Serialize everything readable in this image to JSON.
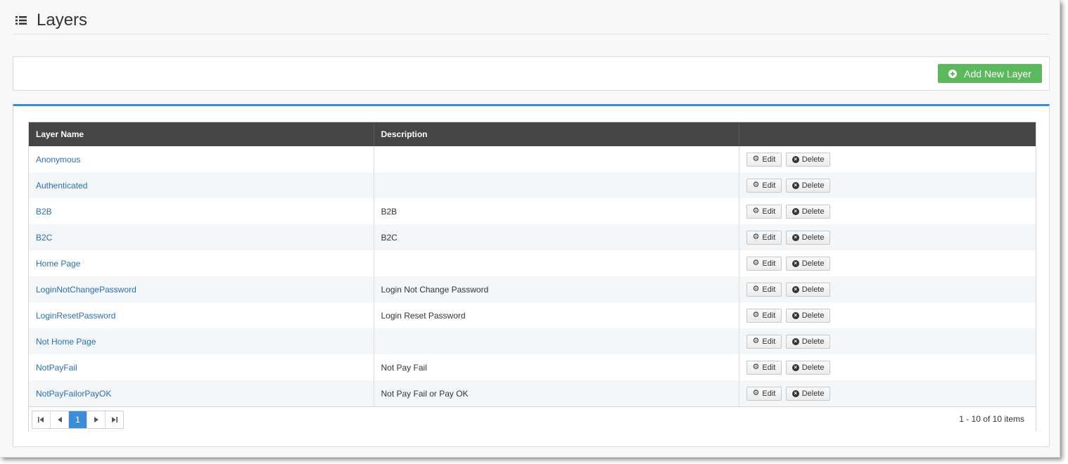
{
  "page": {
    "title": "Layers"
  },
  "toolbar": {
    "add_label": "Add New Layer",
    "add_color": "#5cb85c"
  },
  "grid": {
    "columns": [
      "Layer Name",
      "Description",
      ""
    ],
    "rows": [
      {
        "name": "Anonymous",
        "description": ""
      },
      {
        "name": "Authenticated",
        "description": ""
      },
      {
        "name": "B2B",
        "description": "B2B"
      },
      {
        "name": "B2C",
        "description": "B2C"
      },
      {
        "name": "Home Page",
        "description": ""
      },
      {
        "name": "LoginNotChangePassword",
        "description": "Login Not Change Password"
      },
      {
        "name": "LoginResetPassword",
        "description": "Login Reset Password"
      },
      {
        "name": "Not Home Page",
        "description": ""
      },
      {
        "name": "NotPayFail",
        "description": "Not Pay Fail"
      },
      {
        "name": "NotPayFailorPayOK",
        "description": "Not Pay Fail or Pay OK"
      }
    ],
    "edit_label": "Edit",
    "delete_label": "Delete"
  },
  "pager": {
    "current_page": "1",
    "first_icon": "first-page-icon",
    "prev_icon": "prev-page-icon",
    "next_icon": "next-page-icon",
    "last_icon": "last-page-icon",
    "info": "1 - 10 of 10 items"
  },
  "colors": {
    "accent": "#3c8dd5",
    "header_bg": "#454545",
    "link": "#2a6fb0"
  }
}
